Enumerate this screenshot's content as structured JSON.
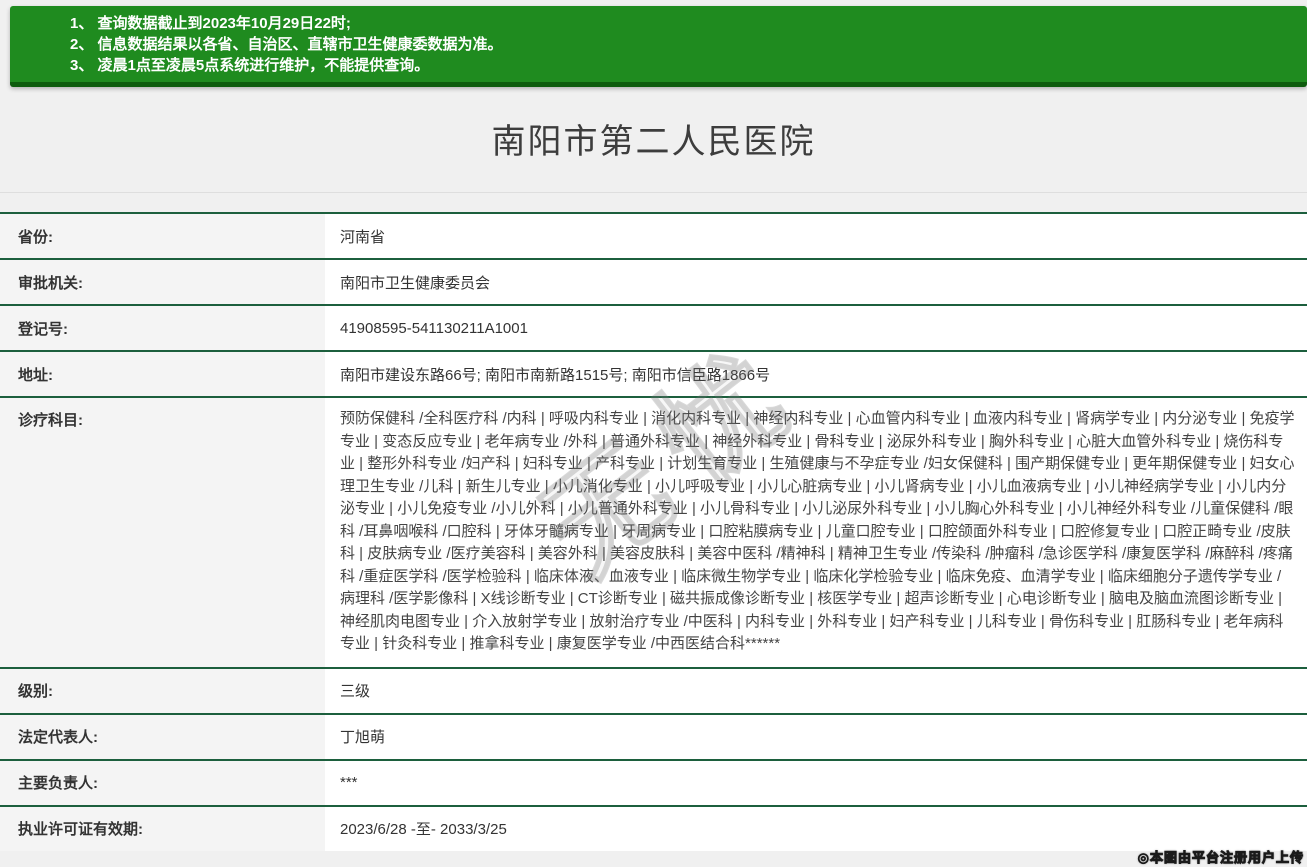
{
  "notice": {
    "items": [
      "1、 查询数据截止到2023年10月29日22时;",
      "2、 信息数据结果以各省、自治区、直辖市卫生健康委数据为准。",
      "3、 凌晨1点至凌晨5点系统进行维护，不能提供查询。"
    ]
  },
  "hospital": {
    "title": "南阳市第二人民医院",
    "fields": [
      {
        "label": "省份:",
        "value": "河南省"
      },
      {
        "label": "审批机关:",
        "value": "南阳市卫生健康委员会"
      },
      {
        "label": "登记号:",
        "value": "41908595-541130211A1001"
      },
      {
        "label": "地址:",
        "value": "南阳市建设东路66号; 南阳市南新路1515号; 南阳市信臣路1866号"
      },
      {
        "label": "诊疗科目:",
        "value": "预防保健科 /全科医疗科 /内科 | 呼吸内科专业 | 消化内科专业 | 神经内科专业 | 心血管内科专业 | 血液内科专业 | 肾病学专业 | 内分泌专业 | 免疫学专业 | 变态反应专业 | 老年病专业 /外科 | 普通外科专业 | 神经外科专业 | 骨科专业 | 泌尿外科专业 | 胸外科专业 | 心脏大血管外科专业 | 烧伤科专业 | 整形外科专业 /妇产科 | 妇科专业 | 产科专业 | 计划生育专业 | 生殖健康与不孕症专业 /妇女保健科 | 围产期保健专业 | 更年期保健专业 | 妇女心理卫生专业 /儿科 | 新生儿专业 | 小儿消化专业 | 小儿呼吸专业 | 小儿心脏病专业 | 小儿肾病专业 | 小儿血液病专业 | 小儿神经病学专业 | 小儿内分泌专业 | 小儿免疫专业 /小儿外科 | 小儿普通外科专业 | 小儿骨科专业 | 小儿泌尿外科专业 | 小儿胸心外科专业 | 小儿神经外科专业 /儿童保健科 /眼科 /耳鼻咽喉科 /口腔科 | 牙体牙髓病专业 | 牙周病专业 | 口腔粘膜病专业 | 儿童口腔专业 | 口腔颌面外科专业 | 口腔修复专业 | 口腔正畸专业 /皮肤科 | 皮肤病专业 /医疗美容科 | 美容外科 | 美容皮肤科 | 美容中医科 /精神科 | 精神卫生专业 /传染科 /肿瘤科 /急诊医学科 /康复医学科 /麻醉科 /疼痛科 /重症医学科 /医学检验科 | 临床体液、血液专业 | 临床微生物学专业 | 临床化学检验专业 | 临床免疫、血清学专业 | 临床细胞分子遗传学专业 /病理科 /医学影像科 | X线诊断专业 | CT诊断专业 | 磁共振成像诊断专业 | 核医学专业 | 超声诊断专业 | 心电诊断专业 | 脑电及脑血流图诊断专业 | 神经肌肉电图专业 | 介入放射学专业 | 放射治疗专业 /中医科 | 内科专业 | 外科专业 | 妇产科专业 | 儿科专业 | 骨伤科专业 | 肛肠科专业 | 老年病科专业 | 针灸科专业 | 推拿科专业 | 康复医学专业 /中西医结合科******"
      },
      {
        "label": "级别:",
        "value": "三级"
      },
      {
        "label": "法定代表人:",
        "value": "丁旭萌"
      },
      {
        "label": "主要负责人:",
        "value": "***"
      },
      {
        "label": "执业许可证有效期:",
        "value": "2023/6/28 -至- 2033/3/25"
      }
    ]
  },
  "watermark": {
    "diagonal_text": "无忧",
    "badge_text": "◎本图由平台注册用户上传"
  },
  "colors": {
    "banner_green": "#1f8b1f",
    "banner_green_dark": "#0d5c0d",
    "row_border_green": "#1c5f3d",
    "label_bg": "#f4f4f4",
    "page_bg": "#f0f0f0"
  }
}
